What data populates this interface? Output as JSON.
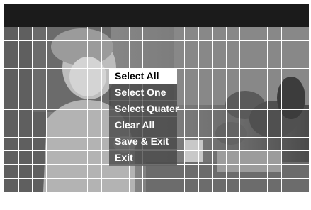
{
  "menu": {
    "items": [
      {
        "label": "Select All",
        "active": true
      },
      {
        "label": "Select One",
        "active": false
      },
      {
        "label": "Select Quater",
        "active": false
      },
      {
        "label": "Clear All",
        "active": false
      },
      {
        "label": "Save & Exit",
        "active": false
      },
      {
        "label": "Exit",
        "active": false
      }
    ]
  },
  "motion_grid": {
    "columns": 22,
    "rows": 12,
    "line_color": "#ffffff",
    "all_cells_selected": true
  }
}
